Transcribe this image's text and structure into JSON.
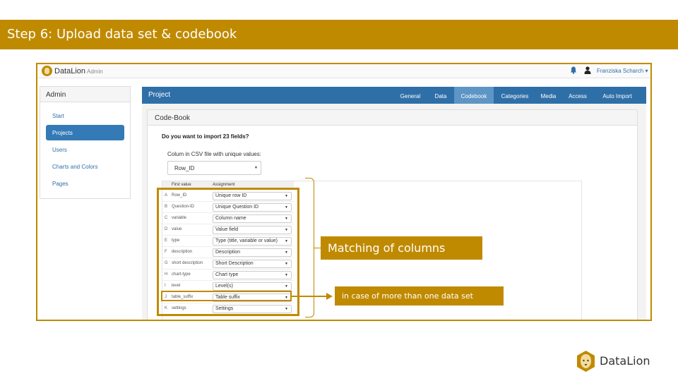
{
  "slide": {
    "title": "Step 6: Upload data set & codebook"
  },
  "app": {
    "brand": "DataLion",
    "brand_sub": "Admin",
    "user_name": "Franziska Scharch ▾"
  },
  "sidebar": {
    "title": "Admin",
    "items": [
      {
        "label": "Start"
      },
      {
        "label": "Projects",
        "active": true
      },
      {
        "label": "Users"
      },
      {
        "label": "Charts and Colors"
      },
      {
        "label": "Pages"
      }
    ]
  },
  "panel": {
    "title": "Project",
    "tabs": [
      {
        "label": "General"
      },
      {
        "label": "Data"
      },
      {
        "label": "Codebook",
        "active": true
      },
      {
        "label": "Categories"
      },
      {
        "label": "Media"
      },
      {
        "label": "Access"
      },
      {
        "label": "Auto Import"
      }
    ]
  },
  "codebook": {
    "title": "Code-Book",
    "question": "Do you want to import 23 fields?",
    "unique_label": "Colum in CSV file with unique values:",
    "unique_value": "Row_ID",
    "columns": {
      "first": "First value",
      "assignment": "Assignment"
    },
    "rows": [
      {
        "letter": "A",
        "first": "Row_ID",
        "assignment": "Unique row ID"
      },
      {
        "letter": "B",
        "first": "Question-ID",
        "assignment": "Unique Question ID"
      },
      {
        "letter": "C",
        "first": "variable",
        "assignment": "Column name"
      },
      {
        "letter": "D",
        "first": "value",
        "assignment": "Value field"
      },
      {
        "letter": "E",
        "first": "type",
        "assignment": "Type (title, variable or value)"
      },
      {
        "letter": "F",
        "first": "description",
        "assignment": "Description"
      },
      {
        "letter": "G",
        "first": "short description",
        "assignment": "Short Description"
      },
      {
        "letter": "H",
        "first": "chart-type",
        "assignment": "Chart type"
      },
      {
        "letter": "I",
        "first": "level",
        "assignment": "Level(s)"
      },
      {
        "letter": "J",
        "first": "table_suffix",
        "assignment": "Table suffix"
      },
      {
        "letter": "K",
        "first": "settings",
        "assignment": "Settings"
      }
    ]
  },
  "annotations": {
    "matching": "Matching of columns",
    "note": "in case of more than one data set"
  },
  "footer": {
    "brand": "DataLion"
  },
  "colors": {
    "accent": "#c08a00",
    "primary": "#2f6fa8",
    "active_tab": "#5d95c6"
  }
}
